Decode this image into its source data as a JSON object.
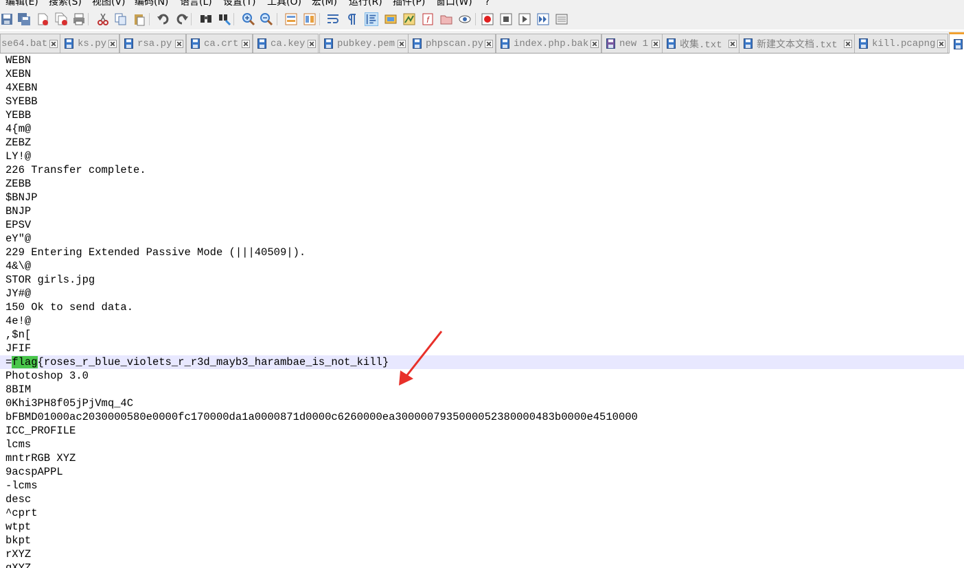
{
  "menu": [
    "编辑(E)",
    "搜索(S)",
    "视图(V)",
    "编码(N)",
    "语言(L)",
    "设置(T)",
    "工具(O)",
    "宏(M)",
    "运行(R)",
    "插件(P)",
    "窗口(W)",
    "?"
  ],
  "toolbar": [
    {
      "name": "save-icon"
    },
    {
      "name": "save-all-icon"
    },
    {
      "name": "close-file-icon"
    },
    {
      "name": "close-all-icon"
    },
    {
      "name": "print-icon"
    },
    {
      "name": "cut-icon"
    },
    {
      "name": "copy-icon"
    },
    {
      "name": "paste-icon"
    },
    {
      "name": "undo-icon"
    },
    {
      "name": "redo-icon"
    },
    {
      "name": "find-icon"
    },
    {
      "name": "replace-icon"
    },
    {
      "name": "zoom-in-icon"
    },
    {
      "name": "zoom-out-icon"
    },
    {
      "name": "sync-vertical-icon"
    },
    {
      "name": "sync-horizontal-icon"
    },
    {
      "name": "word-wrap-icon"
    },
    {
      "name": "show-all-chars-icon"
    },
    {
      "name": "indent-guide-icon"
    },
    {
      "name": "udl-icon"
    },
    {
      "name": "doc-map-icon"
    },
    {
      "name": "function-list-icon"
    },
    {
      "name": "folder-workspace-icon"
    },
    {
      "name": "monitoring-icon"
    },
    {
      "name": "record-macro-icon"
    },
    {
      "name": "stop-record-icon"
    },
    {
      "name": "play-macro-icon"
    },
    {
      "name": "run-macro-multiple-icon"
    },
    {
      "name": "save-macro-icon"
    }
  ],
  "tabs": [
    {
      "label": "se64.bat"
    },
    {
      "label": "ks.py"
    },
    {
      "label": "rsa.py"
    },
    {
      "label": "ca.crt"
    },
    {
      "label": "ca.key"
    },
    {
      "label": "pubkey.pem"
    },
    {
      "label": "phpscan.py"
    },
    {
      "label": "index.php.bak"
    },
    {
      "label": "new 1"
    },
    {
      "label": "收集.txt"
    },
    {
      "label": "新建文本文档.txt"
    },
    {
      "label": "kill.pcapng"
    },
    {
      "label": ""
    }
  ],
  "lines": [
    "WEBN",
    "XEBN",
    "4XEBN",
    "SYEBB",
    "YEBB",
    "4{m@",
    "ZEBZ",
    "LY!@",
    "226 Transfer complete.",
    "ZEBB",
    "$BNJP",
    "BNJP",
    "EPSV",
    "eY\"@",
    "229 Entering Extended Passive Mode (|||40509|).",
    "4&\\@",
    "STOR girls.jpg",
    "JY#@",
    "150 Ok to send data.",
    "4e!@",
    ",$n[",
    "JFIF",
    "=flag{roses_r_blue_violets_r_r3d_mayb3_harambae_is_not_kill}",
    "Photoshop 3.0",
    "8BIM",
    "0Khi3PH8f05jPjVmq_4C",
    "bFBMD01000ac2030000580e0000fc170000da1a0000871d0000c6260000ea3000007935000052380000483b0000e4510000",
    "ICC_PROFILE",
    "lcms",
    "mntrRGB XYZ",
    "9acspAPPL",
    "-lcms",
    "desc",
    "^cprt",
    "wtpt",
    "bkpt",
    "rXYZ",
    "gXYZ"
  ],
  "highlight": {
    "line_index": 22,
    "prefix": "=",
    "word": "flag",
    "suffix": "{roses_r_blue_violets_r_r3d_mayb3_harambae_is_not_kill}"
  },
  "colors": {
    "highlight": "#49c64b",
    "current_line": "#e8e8ff",
    "arrow": "#e8302a",
    "tab_active_accent": "#f0a030"
  }
}
